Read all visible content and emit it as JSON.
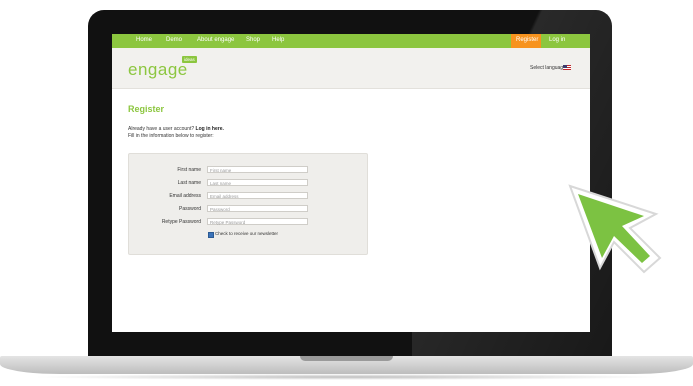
{
  "nav": {
    "items": [
      "Home",
      "Demo",
      "About engage",
      "Shop",
      "Help"
    ],
    "register": "Register",
    "login": "Log in"
  },
  "header": {
    "logo": "engage",
    "logo_badge": "ideas",
    "language_label": "Select language"
  },
  "main": {
    "title": "Register",
    "intro_prefix": "Already have a user account?",
    "intro_link": "Log in here.",
    "intro_line2": "Fill in the information below to register:"
  },
  "form": {
    "fields": [
      {
        "label": "First name",
        "placeholder": "First name"
      },
      {
        "label": "Last name",
        "placeholder": "Last name"
      },
      {
        "label": "Email address",
        "placeholder": "Email address"
      },
      {
        "label": "Password",
        "placeholder": "Password"
      },
      {
        "label": "Retype Password",
        "placeholder": "Retype Password"
      }
    ],
    "newsletter_label": "Check to receive our newsletter",
    "newsletter_checked": true
  },
  "colors": {
    "brand_green": "#8cc63f",
    "register_orange": "#f7931e"
  },
  "icons": [
    "flag-us-icon",
    "checkbox-checked-icon",
    "cursor-arrow-icon"
  ]
}
